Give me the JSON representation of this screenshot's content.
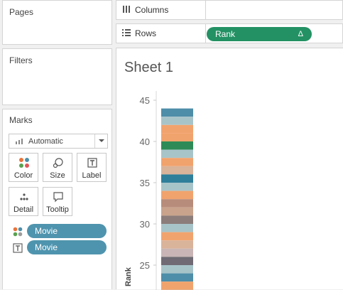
{
  "sidebar": {
    "pages_title": "Pages",
    "filters_title": "Filters",
    "marks_title": "Marks",
    "mark_type": "Automatic",
    "mark_buttons": [
      {
        "label": "Color",
        "icon": "color-dots-icon"
      },
      {
        "label": "Size",
        "icon": "size-icon"
      },
      {
        "label": "Label",
        "icon": "label-icon"
      },
      {
        "label": "Detail",
        "icon": "detail-icon"
      },
      {
        "label": "Tooltip",
        "icon": "tooltip-icon"
      }
    ],
    "mark_pills": [
      {
        "icon": "color-dots-icon",
        "field": "Movie"
      },
      {
        "icon": "label-icon",
        "field": "Movie"
      }
    ]
  },
  "shelves": {
    "columns_label": "Columns",
    "rows_label": "Rows",
    "rows_pill": "Rank",
    "rows_pill_indicator": "Δ"
  },
  "sheet": {
    "title": "Sheet 1"
  },
  "colors": {
    "pill_blue": "#4f94ae",
    "pill_green": "#239163"
  },
  "chart_data": {
    "type": "bar",
    "orientation": "vertical-stacked",
    "ylabel": "Rank",
    "yticks": [
      25,
      30,
      35,
      40,
      45
    ],
    "ylim": [
      21.5,
      46.5
    ],
    "stack_top": 44,
    "segment_colors": [
      "#4e8ea8",
      "#a7c4c9",
      "#f1a36d",
      "#f1a36d",
      "#2e8b57",
      "#a7c4c9",
      "#f1a36d",
      "#d9b39a",
      "#2f7f9a",
      "#a7c4c9",
      "#f1a36d",
      "#b88c7a",
      "#c9a38c",
      "#8c7d7a",
      "#a7c4c9",
      "#f1a36d",
      "#d9b39a",
      "#c9b5b5",
      "#6f6a73",
      "#a7c4c9",
      "#4e8ea8",
      "#f1a36d",
      "#b9b3a8"
    ]
  }
}
